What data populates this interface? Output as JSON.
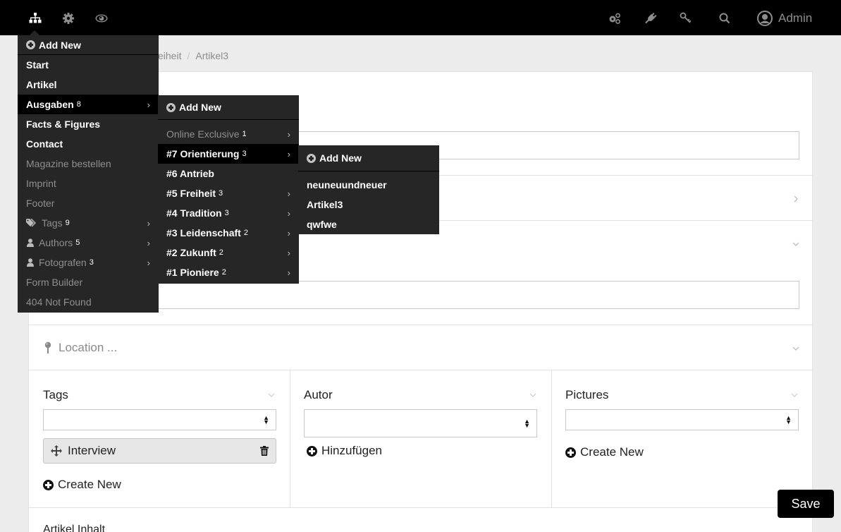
{
  "topbar": {
    "left_icons": [
      "sitemap-icon",
      "gear-icon",
      "eye-icon"
    ],
    "right_icons": [
      "cogs-icon",
      "plug-icon",
      "key-icon",
      "search-icon"
    ],
    "user_label": "Admin"
  },
  "breadcrumb": {
    "items": [
      "eiheit",
      "Artikel3"
    ],
    "separator": "/"
  },
  "menu_main": {
    "add_new": "Add New",
    "items": [
      {
        "label": "Start",
        "count": "",
        "style": "bold"
      },
      {
        "label": "Artikel",
        "count": "",
        "style": "bold"
      },
      {
        "label": "Ausgaben",
        "count": "8",
        "style": "bold",
        "submenu": true,
        "active": true
      },
      {
        "label": "Facts & Figures",
        "count": "",
        "style": "bold"
      },
      {
        "label": "Contact",
        "count": "",
        "style": "bold"
      },
      {
        "label": "Magazine bestellen",
        "count": "",
        "style": "dim"
      },
      {
        "label": "Imprint",
        "count": "",
        "style": "dim"
      },
      {
        "label": "Footer",
        "count": "",
        "style": "dim"
      },
      {
        "label": "Tags",
        "count": "9",
        "style": "dim",
        "icon": "tags-icon",
        "submenu": true
      },
      {
        "label": "Authors",
        "count": "5",
        "style": "dim",
        "icon": "user-icon",
        "submenu": true
      },
      {
        "label": "Fotografen",
        "count": "3",
        "style": "dim",
        "icon": "user-icon",
        "submenu": true
      },
      {
        "label": "Form Builder",
        "count": "",
        "style": "dim"
      },
      {
        "label": "404 Not Found",
        "count": "",
        "style": "dim"
      }
    ]
  },
  "menu_ausgaben": {
    "add_new": "Add New",
    "items": [
      {
        "label": "Online Exclusive",
        "count": "1",
        "style": "dim",
        "submenu": true
      },
      {
        "label": "#7 Orientierung",
        "count": "3",
        "style": "bold",
        "submenu": true,
        "active": true
      },
      {
        "label": "#6 Antrieb",
        "count": "",
        "style": "bold"
      },
      {
        "label": "#5 Freiheit",
        "count": "3",
        "style": "bold",
        "submenu": true
      },
      {
        "label": "#4 Tradition",
        "count": "3",
        "style": "bold",
        "submenu": true
      },
      {
        "label": "#3 Leidenschaft",
        "count": "2",
        "style": "bold",
        "submenu": true
      },
      {
        "label": "#2 Zukunft",
        "count": "2",
        "style": "bold",
        "submenu": true
      },
      {
        "label": "#1 Pioniere",
        "count": "2",
        "style": "bold",
        "submenu": true
      }
    ]
  },
  "menu_orientierung": {
    "add_new": "Add New",
    "items": [
      {
        "label": "neuneuundneuer"
      },
      {
        "label": "Artikel3"
      },
      {
        "label": "qwfwe"
      }
    ]
  },
  "form": {
    "location_placeholder": "Location ...",
    "tags": {
      "title": "Tags",
      "selected_value": "",
      "chips": [
        "Interview"
      ],
      "create_label": "Create New"
    },
    "autor": {
      "title": "Autor",
      "selected_value": "",
      "add_label": "Hinzufügen"
    },
    "pictures": {
      "title": "Pictures",
      "selected_value": "",
      "create_label": "Create New"
    },
    "next_section_label": "Artikel Inhalt"
  },
  "save_label": "Save",
  "colors": {
    "topbar_bg": "#000000",
    "menu_bg": "#262626",
    "menu_active_bg": "#000000",
    "page_bg": "#ececec",
    "save_bg": "#000000"
  }
}
